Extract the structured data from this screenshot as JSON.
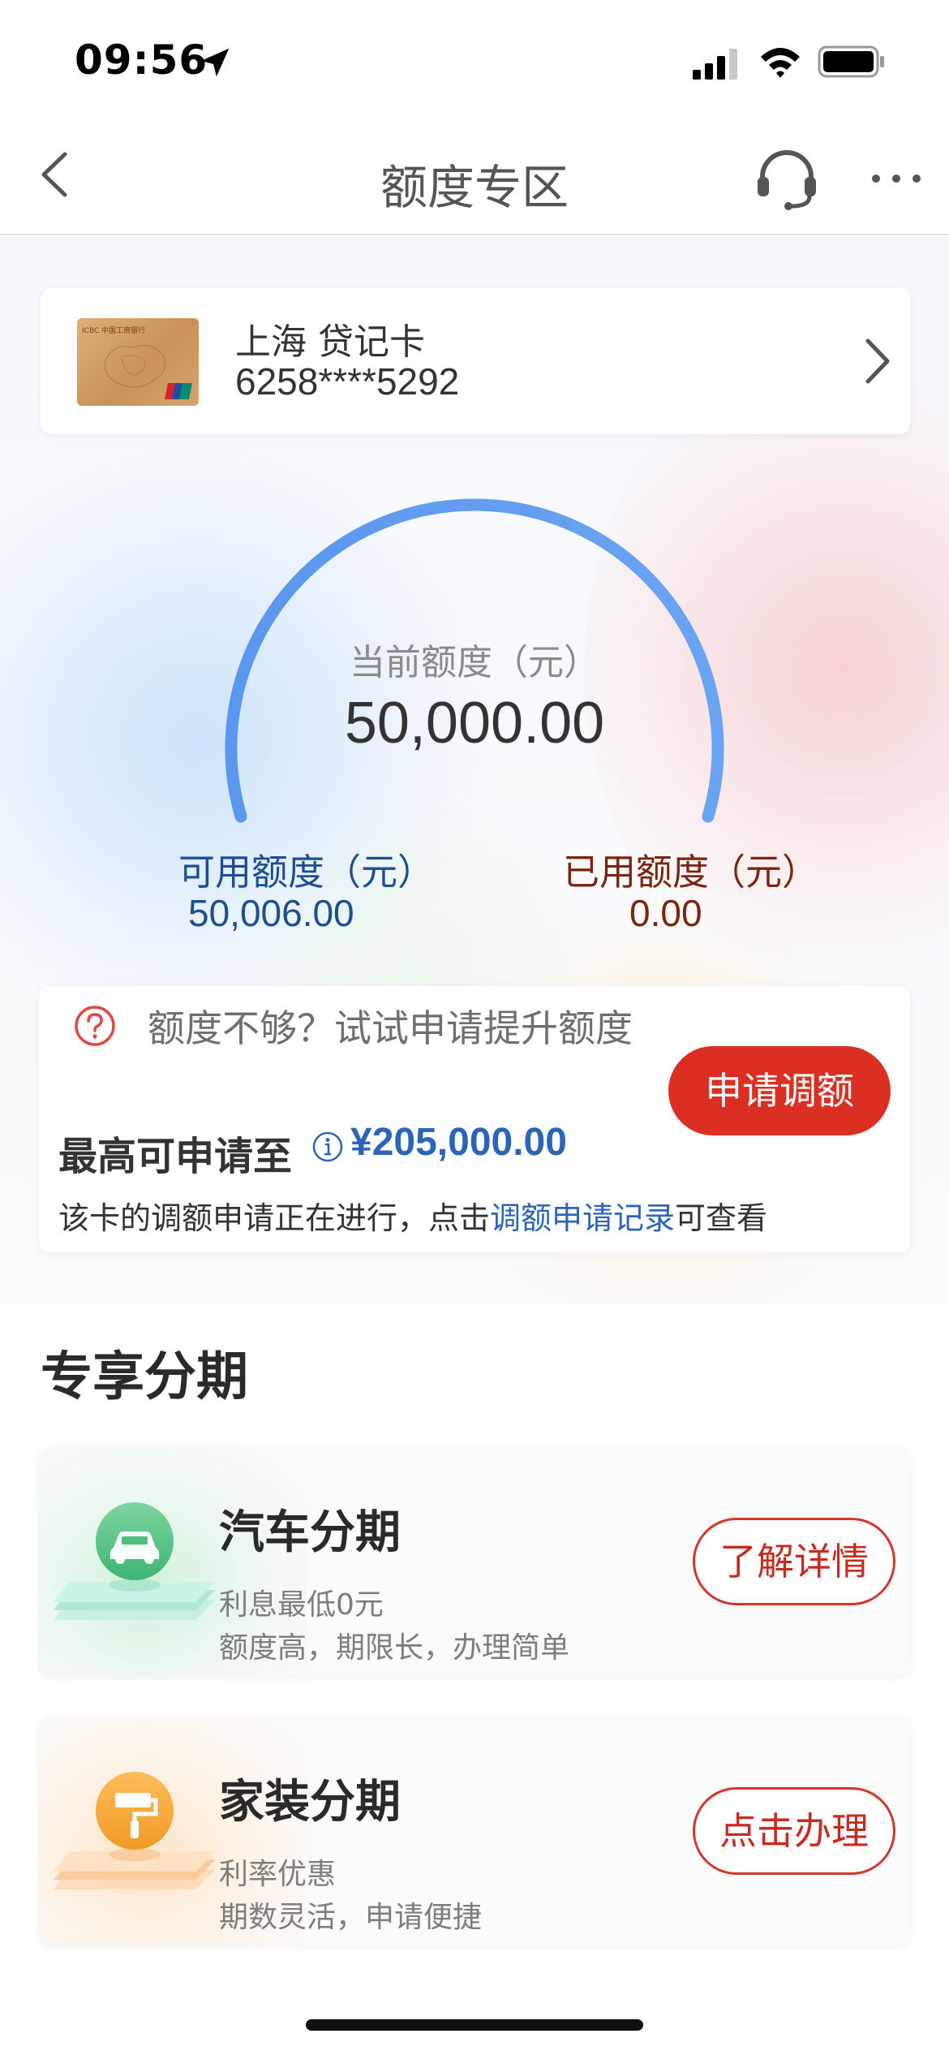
{
  "status_bar": {
    "time": "09:56"
  },
  "nav": {
    "title": "额度专区"
  },
  "card": {
    "name": "上海 贷记卡",
    "number": "6258****5292",
    "image_text": "ICBC 中国工商银行"
  },
  "limit": {
    "current_label": "当前额度（元）",
    "current_value": "50,000.00",
    "available_label": "可用额度（元）",
    "available_value": "50,006.00",
    "used_label": "已用额度（元）",
    "used_value": "0.00"
  },
  "increase": {
    "prompt": "额度不够？试试申请提升额度",
    "max_label": "最高可申请至",
    "max_amount": "¥205,000.00",
    "note_prefix": "该卡的调额申请正在进行，点击",
    "note_link": "调额申请记录",
    "note_suffix": "可查看",
    "apply_label": "申请调额"
  },
  "installments": {
    "section_title": "专享分期",
    "items": [
      {
        "title": "汽车分期",
        "line1": "利息最低0元",
        "line2": "额度高，期限长，办理简单",
        "button": "了解详情",
        "icon": "car-icon"
      },
      {
        "title": "家装分期",
        "line1": "利率优惠",
        "line2": "期数灵活，申请便捷",
        "button": "点击办理",
        "icon": "paint-roller-icon"
      }
    ]
  },
  "colors": {
    "accent_red": "#dc2f24",
    "link_blue": "#2c64b8",
    "gauge_blue": "#5b9bf0",
    "available_blue": "#1d4e94",
    "used_brown": "#7b2410"
  }
}
